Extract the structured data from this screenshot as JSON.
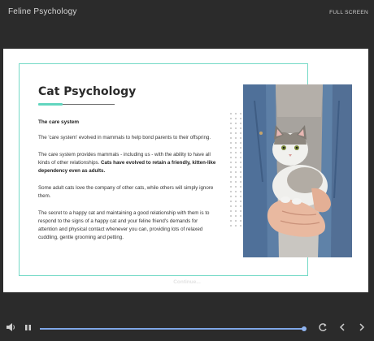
{
  "app": {
    "title": "Feline Psychology",
    "fullscreen_label": "FULL SCREEN"
  },
  "slide": {
    "heading": "Cat Psychology",
    "subheading": "The care system",
    "paragraphs": [
      {
        "text": "The 'care system' evolved in mammals to help bond parents to their offspring."
      },
      {
        "text": "The care system provides mammals - including us - with the ability to have all kinds of other relationships. ",
        "bold": "Cats have evolved to retain a friendly, kitten-like dependency even as adults."
      },
      {
        "text": "Some adult cats love the company of other cats, while others will simply ignore them."
      },
      {
        "text": "The secret to a happy cat and maintaining a good relationship with them is to respond to the signs of a happy cat and your feline friend's demands for attention and physical contact whenever you can, providing lots of relaxed cuddling, gentle grooming and petting."
      }
    ],
    "image_alt": "photo-cat-held-in-arms"
  },
  "continue_label": "Continue...",
  "player": {
    "progress_fraction": 0.99,
    "icons": [
      "volume-icon",
      "pause-icon",
      "replay-icon",
      "prev-icon",
      "next-icon"
    ]
  },
  "colors": {
    "accent": "#74d9c6",
    "progress": "#7fa7e8",
    "background": "#2b2b2b"
  }
}
